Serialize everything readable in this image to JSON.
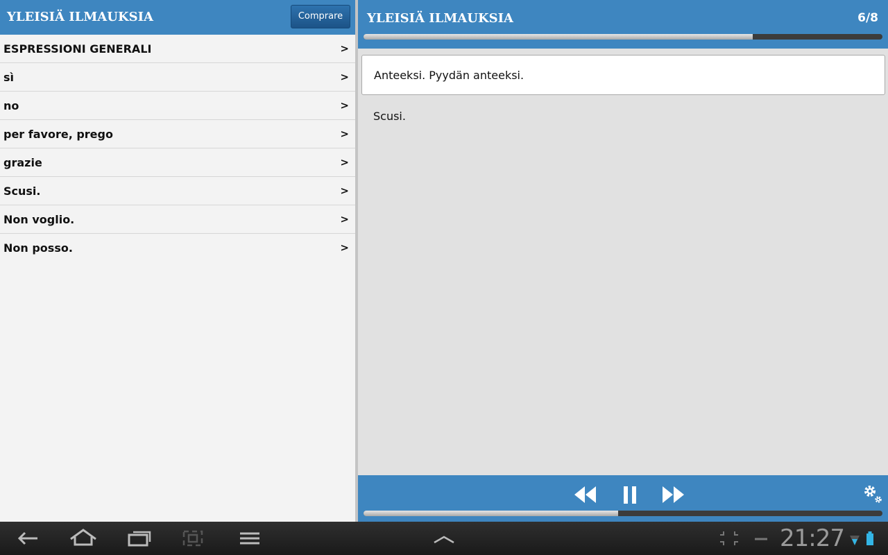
{
  "left_pane": {
    "title": "YLEISIÄ ILMAUKSIA",
    "buy_button": "Comprare",
    "items": [
      {
        "label": "ESPRESSIONI GENERALI",
        "chevron": ">"
      },
      {
        "label": "sì",
        "chevron": ">"
      },
      {
        "label": "no",
        "chevron": ">"
      },
      {
        "label": "per favore, prego",
        "chevron": ">"
      },
      {
        "label": "grazie",
        "chevron": ">"
      },
      {
        "label": "Scusi.",
        "chevron": ">"
      },
      {
        "label": "Non voglio.",
        "chevron": ">"
      },
      {
        "label": "Non posso.",
        "chevron": ">"
      }
    ]
  },
  "right_pane": {
    "title": "YLEISIÄ ILMAUKSIA",
    "counter": "6/8",
    "phrase": "Anteeksi. Pyydän anteeksi.",
    "translation": "Scusi.",
    "phrase_progress": 0.75,
    "playback_progress": 0.49
  },
  "player": {
    "icons": [
      "rewind-icon",
      "pause-icon",
      "fast-forward-icon",
      "settings-gear-icon"
    ]
  },
  "system_bar": {
    "clock": "21:27",
    "icons": [
      "back-icon",
      "home-icon",
      "recent-apps-icon",
      "screenshot-icon",
      "menu-icon",
      "chevron-up-icon",
      "expand-icon",
      "minus-icon",
      "wifi-icon",
      "battery-icon"
    ]
  },
  "colors": {
    "header_blue": "#3e86c0",
    "button_blue": "#1c5387",
    "list_bg": "#f3f3f3",
    "content_bg": "#e1e1e1",
    "system_bar": "#1e1e1e"
  }
}
